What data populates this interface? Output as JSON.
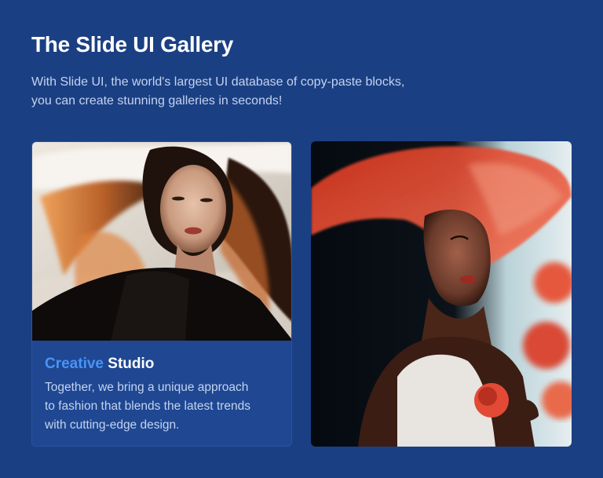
{
  "header": {
    "title": "The Slide UI Gallery",
    "subtitle_line1": "With Slide UI, the world's largest UI database of copy-paste blocks,",
    "subtitle_line2": "you can create stunning galleries in seconds!"
  },
  "cards": [
    {
      "title_accent": "Creative",
      "title_rest": "Studio",
      "text_line1": "Together, we bring a unique approach",
      "text_line2": "to fashion that blends the latest trends",
      "text_line3": "with cutting-edge design."
    }
  ],
  "colors": {
    "background": "#1b3f83",
    "accent": "#4a93f6",
    "card_background": "#1f4792"
  }
}
